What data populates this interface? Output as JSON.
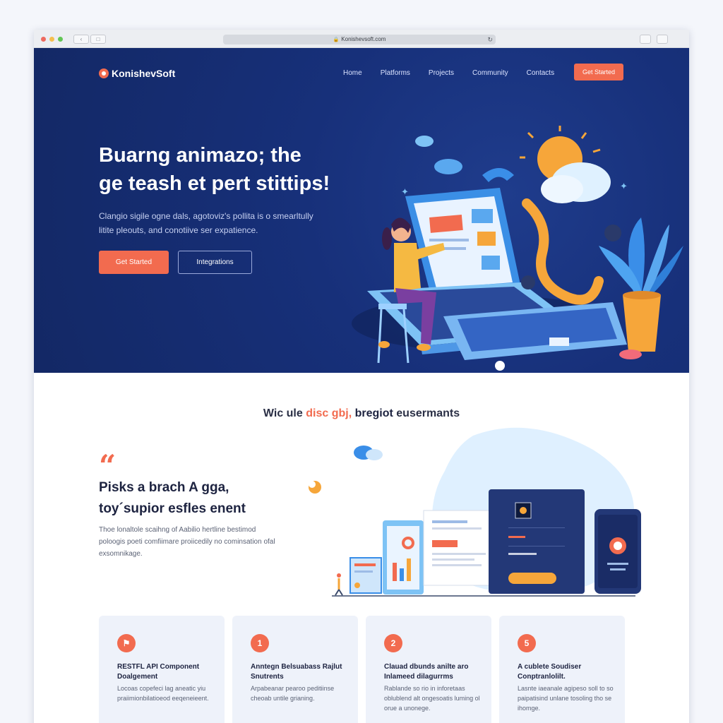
{
  "browser": {
    "address": "Konishevsoft.com",
    "back_icon": "back-arrow-icon",
    "reload_icon": "reload-icon"
  },
  "header": {
    "logo": "KonishevSoft",
    "nav": [
      "Home",
      "Platforms",
      "Projects",
      "Community",
      "Contacts"
    ],
    "cta": "Get Started"
  },
  "hero": {
    "title_line1": "Buarng animazo; the",
    "title_line2": "ge teash et pert stittips!",
    "subtitle_line1": "Clangio sigile ogne dals, agotoviz's pollita is o smearltully",
    "subtitle_line2": "litite pleouts, and conotiive ser expatience.",
    "primary_button": "Get Started",
    "secondary_button": "Integrations"
  },
  "section_heading": {
    "prefix": "Wic ule",
    "accent": "disc gbj,",
    "strong": "bregiot",
    "suffix": "eusermants"
  },
  "testimonial": {
    "title_line1": "Pisks a brach A gga,",
    "title_line2": "toy´supior esfles enent",
    "text_line1": "Thoe lonaltole scaihng of Aabilio hertline bestimod",
    "text_line2": "poloogis poeti comfiimare proiicedily no cominsation ofal",
    "text_line3": "exsomnikage."
  },
  "cards": [
    {
      "num": "⚑",
      "title": "RESTFL API Component Doalgement",
      "text": "Locoas copefeci lag aneatic yiu praiimionbilatioeod eeqeneieent."
    },
    {
      "num": "1",
      "title": "Anntegn Belsuabass Rajlut Snutrents",
      "text": "Arpabeanar pearoo peditiinse cheoab untile grianing."
    },
    {
      "num": "2",
      "title": "Clauad dbunds anilte aro Inlameed dilagurrms",
      "text": "Rablande so rio in inforetaas oblublend alt ongesoatis luming ol orue a unonege."
    },
    {
      "num": "5",
      "title": "A cublete Soudiser Conptranlolilt.",
      "text": "Lasnte iaeanale agipeso soll to so paipatisind unlane tosoling tho se ihomge."
    }
  ],
  "colors": {
    "accent": "#f26b4f",
    "hero_bg": "#17307a",
    "card_bg": "#eef2fa"
  }
}
